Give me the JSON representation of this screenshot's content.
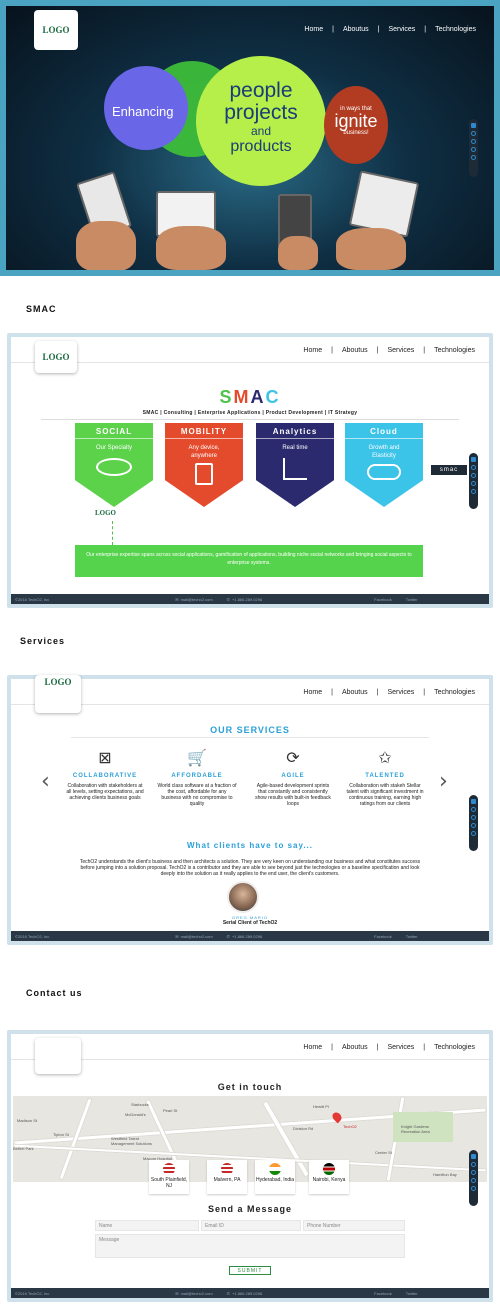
{
  "nav": {
    "home": "Home",
    "about": "Aboutus",
    "services": "Services",
    "tech": "Technologies",
    "sep": "|"
  },
  "logo": "LOGO",
  "hero": {
    "enhancing": "Enhancing",
    "line1": "people",
    "line2": "projects",
    "line3": "and",
    "line4": "products",
    "ways": "in ways that",
    "ignite": "ignite",
    "business": "business!"
  },
  "sections": {
    "smac": "SMAC",
    "services": "Services",
    "contact": "Contact us"
  },
  "smac": {
    "heading": "SMAC",
    "heading_letters": [
      "S",
      "M",
      "A",
      "C"
    ],
    "menu": "SMAC  |  Consulting  |  Enterprise Applications  |  Product Development  |  IT Strategy",
    "tag": "smac",
    "cards": [
      {
        "title": "SOCIAL",
        "desc": "Our Specialty",
        "color": "#5bd24a"
      },
      {
        "title": "MOBILITY",
        "desc": "Any device, anywhere",
        "color": "#e44a2c"
      },
      {
        "title": "Analytics",
        "desc": "Real time",
        "color": "#2b2a6e"
      },
      {
        "title": "Cloud",
        "desc": "Growth and Elasticity",
        "color": "#3cc3e8"
      }
    ],
    "logo": "LOGO",
    "bar_text": "Our enterprise expertise spans across social applications, gamification of applications, building niche social networks and bringing social aspects to enterprise systems."
  },
  "footer": {
    "copy": "©2016 TechO2, Inc",
    "mail": "mail@techo2.com",
    "phone": "+1.866.289.0296",
    "facebook": "Facebook",
    "twitter": "Twitter"
  },
  "services": {
    "heading": "OUR SERVICES",
    "items": [
      {
        "title": "COLLABORATIVE",
        "text": "Collaboration with stakeholders at all levels, setting expectations, and achieving clients business goals",
        "icon": "network-icon"
      },
      {
        "title": "AFFORDABLE",
        "text": "World class software at a fraction of the cost, affordable for any business with no compromise to quality",
        "icon": "cart-icon"
      },
      {
        "title": "AGILE",
        "text": "Agile-based development sprints that constantly and consistently show results with built-in feedback loops",
        "icon": "cycle-icon"
      },
      {
        "title": "TALENTED",
        "text": "Collaboration with stakeh Stellar talent with significant investment in continuous training, earning high ratings from our clients",
        "icon": "stars-icon"
      }
    ],
    "clients_heading": "What clients have to say...",
    "testimonial": "TechO2 understands the client's business and then architects a solution. They are very keen on understanding our business and what constitutes success before jumping into a solution proposal. TechO2 is a contributor and they are able to see beyond just the technologies or a baseline specification and look deeply into the solution as it really applies to the end user, the client's customers.",
    "client_name": "GREG MARIO",
    "client_role": "Serial Client of TechO2"
  },
  "contact": {
    "heading": "Get in touch",
    "map_label": "TechO2",
    "map_labels": [
      "Madison St",
      "Tipton St",
      "Bethel Park",
      "Westfield Talent Management Solutions",
      "Macom Hospital",
      "Pearl St",
      "McDonald's",
      "Starbucks",
      "Knight Gardens Recreation Area",
      "Hamilton Bay",
      "Division Rd",
      "Hewitt Pl",
      "Center St"
    ],
    "offices": [
      {
        "name": "South Plainfield, NJ",
        "flag": "us"
      },
      {
        "name": "Malvern, PA",
        "flag": "us"
      },
      {
        "name": "Hyderabad, India",
        "flag": "in"
      },
      {
        "name": "Nairobi, Kenya",
        "flag": "ke"
      }
    ],
    "send_heading": "Send a Message",
    "name_placeholder": "Name",
    "email_placeholder": "Email ID",
    "phone_placeholder": "Phone Number",
    "message_placeholder": "Message",
    "submit": "SUBMIT"
  }
}
